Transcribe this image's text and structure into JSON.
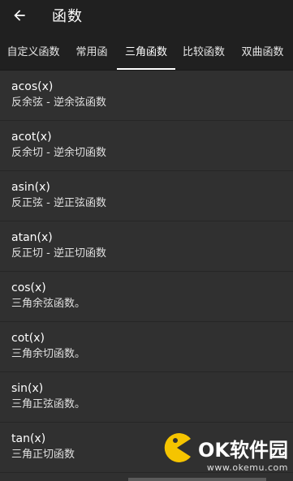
{
  "appbar": {
    "title": "函数",
    "back_icon": "arrow-left-icon"
  },
  "tabs": [
    {
      "label": "自定义函数",
      "active": false
    },
    {
      "label": "常用函",
      "active": false
    },
    {
      "label": "三角函数",
      "active": true
    },
    {
      "label": "比较函数",
      "active": false
    },
    {
      "label": "双曲函数",
      "active": false
    }
  ],
  "functions": [
    {
      "name": "acos(x)",
      "desc": "反余弦 - 逆余弦函数"
    },
    {
      "name": "acot(x)",
      "desc": "反余切 - 逆余切函数"
    },
    {
      "name": "asin(x)",
      "desc": "反正弦 - 逆正弦函数"
    },
    {
      "name": "atan(x)",
      "desc": "反正切 - 逆正切函数"
    },
    {
      "name": "cos(x)",
      "desc": "三角余弦函数。"
    },
    {
      "name": "cot(x)",
      "desc": "三角余切函数。"
    },
    {
      "name": "sin(x)",
      "desc": "三角正弦函数。"
    },
    {
      "name": "tan(x)",
      "desc": "三角正切函数"
    }
  ],
  "watermark": {
    "brand": "OK软件园",
    "url": "www.okemu.com",
    "logo_icon": "pacman-logo-icon",
    "logo_color": "#f5c400"
  },
  "colors": {
    "appbar_bg": "#202020",
    "list_bg": "#303030",
    "divider": "#262626",
    "text": "#ffffff"
  }
}
